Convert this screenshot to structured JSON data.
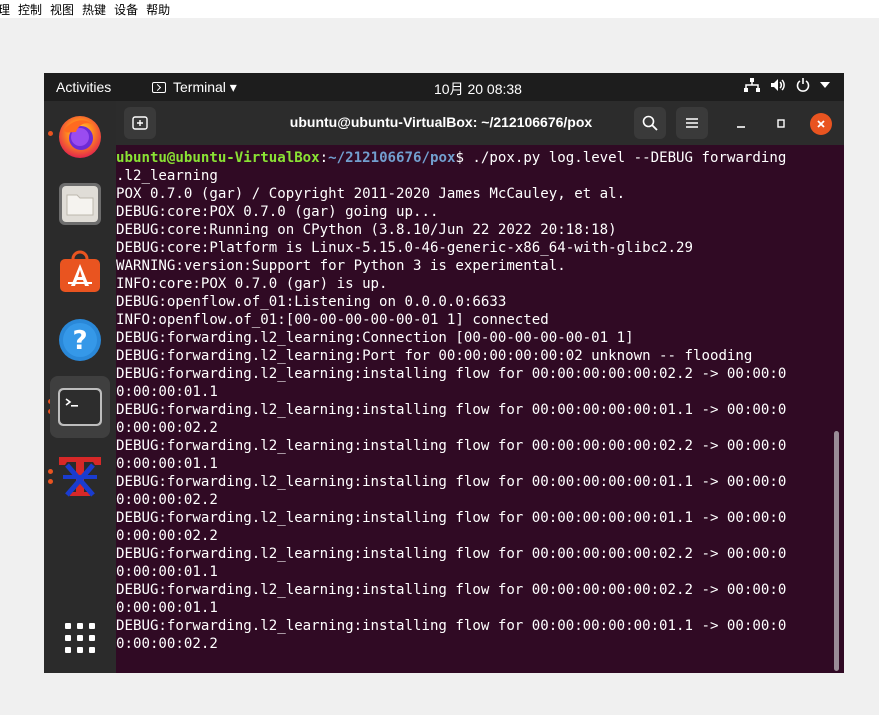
{
  "vbox_menu": [
    "理",
    "控制",
    "视图",
    "热键",
    "设备",
    "帮助"
  ],
  "topbar": {
    "activities": "Activities",
    "app_label": "Terminal ▾",
    "clock": "10月 20  08:38"
  },
  "terminal": {
    "title": "ubuntu@ubuntu-VirtualBox: ~/212106676/pox",
    "prompt_user": "ubuntu@ubuntu-VirtualBox",
    "prompt_sep": ":",
    "prompt_path": "~/212106676/pox",
    "prompt_cmd": "$ ./pox.py log.level --DEBUG forwarding",
    "lines": [
      ".l2_learning",
      "POX 0.7.0 (gar) / Copyright 2011-2020 James McCauley, et al.",
      "DEBUG:core:POX 0.7.0 (gar) going up...",
      "DEBUG:core:Running on CPython (3.8.10/Jun 22 2022 20:18:18)",
      "DEBUG:core:Platform is Linux-5.15.0-46-generic-x86_64-with-glibc2.29",
      "WARNING:version:Support for Python 3 is experimental.",
      "INFO:core:POX 0.7.0 (gar) is up.",
      "DEBUG:openflow.of_01:Listening on 0.0.0.0:6633",
      "INFO:openflow.of_01:[00-00-00-00-00-01 1] connected",
      "DEBUG:forwarding.l2_learning:Connection [00-00-00-00-00-01 1]",
      "DEBUG:forwarding.l2_learning:Port for 00:00:00:00:00:02 unknown -- flooding",
      "DEBUG:forwarding.l2_learning:installing flow for 00:00:00:00:00:02.2 -> 00:00:0",
      "0:00:00:01.1",
      "DEBUG:forwarding.l2_learning:installing flow for 00:00:00:00:00:01.1 -> 00:00:0",
      "0:00:00:02.2",
      "DEBUG:forwarding.l2_learning:installing flow for 00:00:00:00:00:02.2 -> 00:00:0",
      "0:00:00:01.1",
      "DEBUG:forwarding.l2_learning:installing flow for 00:00:00:00:00:01.1 -> 00:00:0",
      "0:00:00:02.2",
      "DEBUG:forwarding.l2_learning:installing flow for 00:00:00:00:00:01.1 -> 00:00:0",
      "0:00:00:02.2",
      "DEBUG:forwarding.l2_learning:installing flow for 00:00:00:00:00:02.2 -> 00:00:0",
      "0:00:00:01.1",
      "DEBUG:forwarding.l2_learning:installing flow for 00:00:00:00:00:02.2 -> 00:00:0",
      "0:00:00:01.1",
      "DEBUG:forwarding.l2_learning:installing flow for 00:00:00:00:00:01.1 -> 00:00:0",
      "0:00:00:02.2"
    ]
  },
  "dock": [
    "firefox-icon",
    "files-icon",
    "software-icon",
    "help-icon",
    "terminal-icon",
    "tex-icon",
    "show-apps-icon"
  ],
  "colors": {
    "terminal_bg": "#300a24",
    "prompt_user": "#8ae234",
    "prompt_path": "#729fcf",
    "close": "#e95420"
  }
}
